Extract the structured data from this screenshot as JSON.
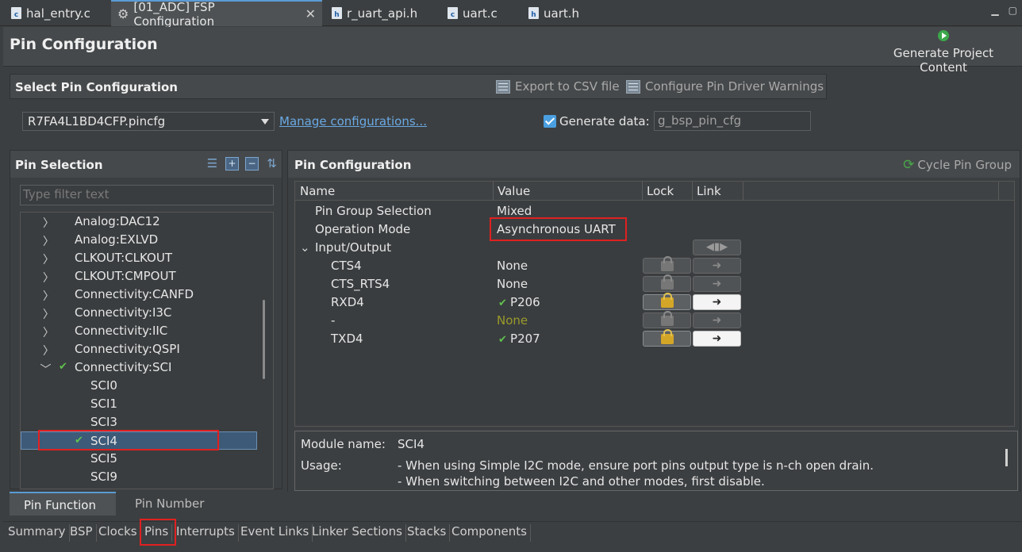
{
  "editor_tabs": [
    {
      "label": "hal_entry.c"
    },
    {
      "label": "[01_ADC] FSP Configuration"
    },
    {
      "label": "r_uart_api.h"
    },
    {
      "label": "uart.c"
    },
    {
      "label": "uart.h"
    }
  ],
  "header": {
    "title": "Pin Configuration",
    "generate_label": "Generate Project Content"
  },
  "select_section": {
    "title": "Select Pin Configuration",
    "export_label": "Export to CSV file",
    "warnings_label": "Configure Pin Driver Warnings",
    "config_file": "R7FA4L1BD4CFP.pincfg",
    "manage_link": "Manage configurations...",
    "generate_label": "Generate data:",
    "generate_value": "g_bsp_pin_cfg",
    "generate_checked": true
  },
  "pin_selection": {
    "title": "Pin Selection",
    "filter_placeholder": "Type filter text",
    "items": [
      {
        "label": "Analog:DAC12"
      },
      {
        "label": "Analog:EXLVD"
      },
      {
        "label": "CLKOUT:CLKOUT"
      },
      {
        "label": "CLKOUT:CMPOUT"
      },
      {
        "label": "Connectivity:CANFD"
      },
      {
        "label": "Connectivity:I3C"
      },
      {
        "label": "Connectivity:IIC"
      },
      {
        "label": "Connectivity:QSPI"
      },
      {
        "label": "Connectivity:SCI"
      },
      {
        "label": "SCI0"
      },
      {
        "label": "SCI1"
      },
      {
        "label": "SCI3"
      },
      {
        "label": "SCI4"
      },
      {
        "label": "SCI5"
      },
      {
        "label": "SCI9"
      }
    ]
  },
  "pin_config": {
    "title": "Pin Configuration",
    "cycle_label": "Cycle Pin Group",
    "columns": {
      "name": "Name",
      "value": "Value",
      "lock": "Lock",
      "link": "Link"
    },
    "rows": [
      {
        "name": "Pin Group Selection",
        "value": "Mixed"
      },
      {
        "name": "Operation Mode",
        "value": "Asynchronous UART"
      },
      {
        "name": "Input/Output",
        "value": ""
      },
      {
        "name": "CTS4",
        "value": "None"
      },
      {
        "name": "CTS_RTS4",
        "value": "None"
      },
      {
        "name": "RXD4",
        "value": "P206"
      },
      {
        "name": "-",
        "value": "None"
      },
      {
        "name": "TXD4",
        "value": "P207"
      }
    ],
    "details": {
      "module_label": "Module name:",
      "module_value": "SCI4",
      "usage_label": "Usage:",
      "usage_line1": "- When using Simple I2C mode, ensure port pins output type is n-ch open drain.",
      "usage_line2": "- When switching between I2C and other modes, first disable."
    }
  },
  "sub_tabs": [
    {
      "label": "Pin Function"
    },
    {
      "label": "Pin Number"
    }
  ],
  "bottom_tabs": [
    {
      "label": "Summary"
    },
    {
      "label": "BSP"
    },
    {
      "label": "Clocks"
    },
    {
      "label": "Pins"
    },
    {
      "label": "Interrupts"
    },
    {
      "label": "Event Links"
    },
    {
      "label": "Linker Sections"
    },
    {
      "label": "Stacks"
    },
    {
      "label": "Components"
    }
  ],
  "colors": {
    "accent": "#5a9bd5",
    "highlight": "#e02020",
    "check": "#5fc24f"
  }
}
